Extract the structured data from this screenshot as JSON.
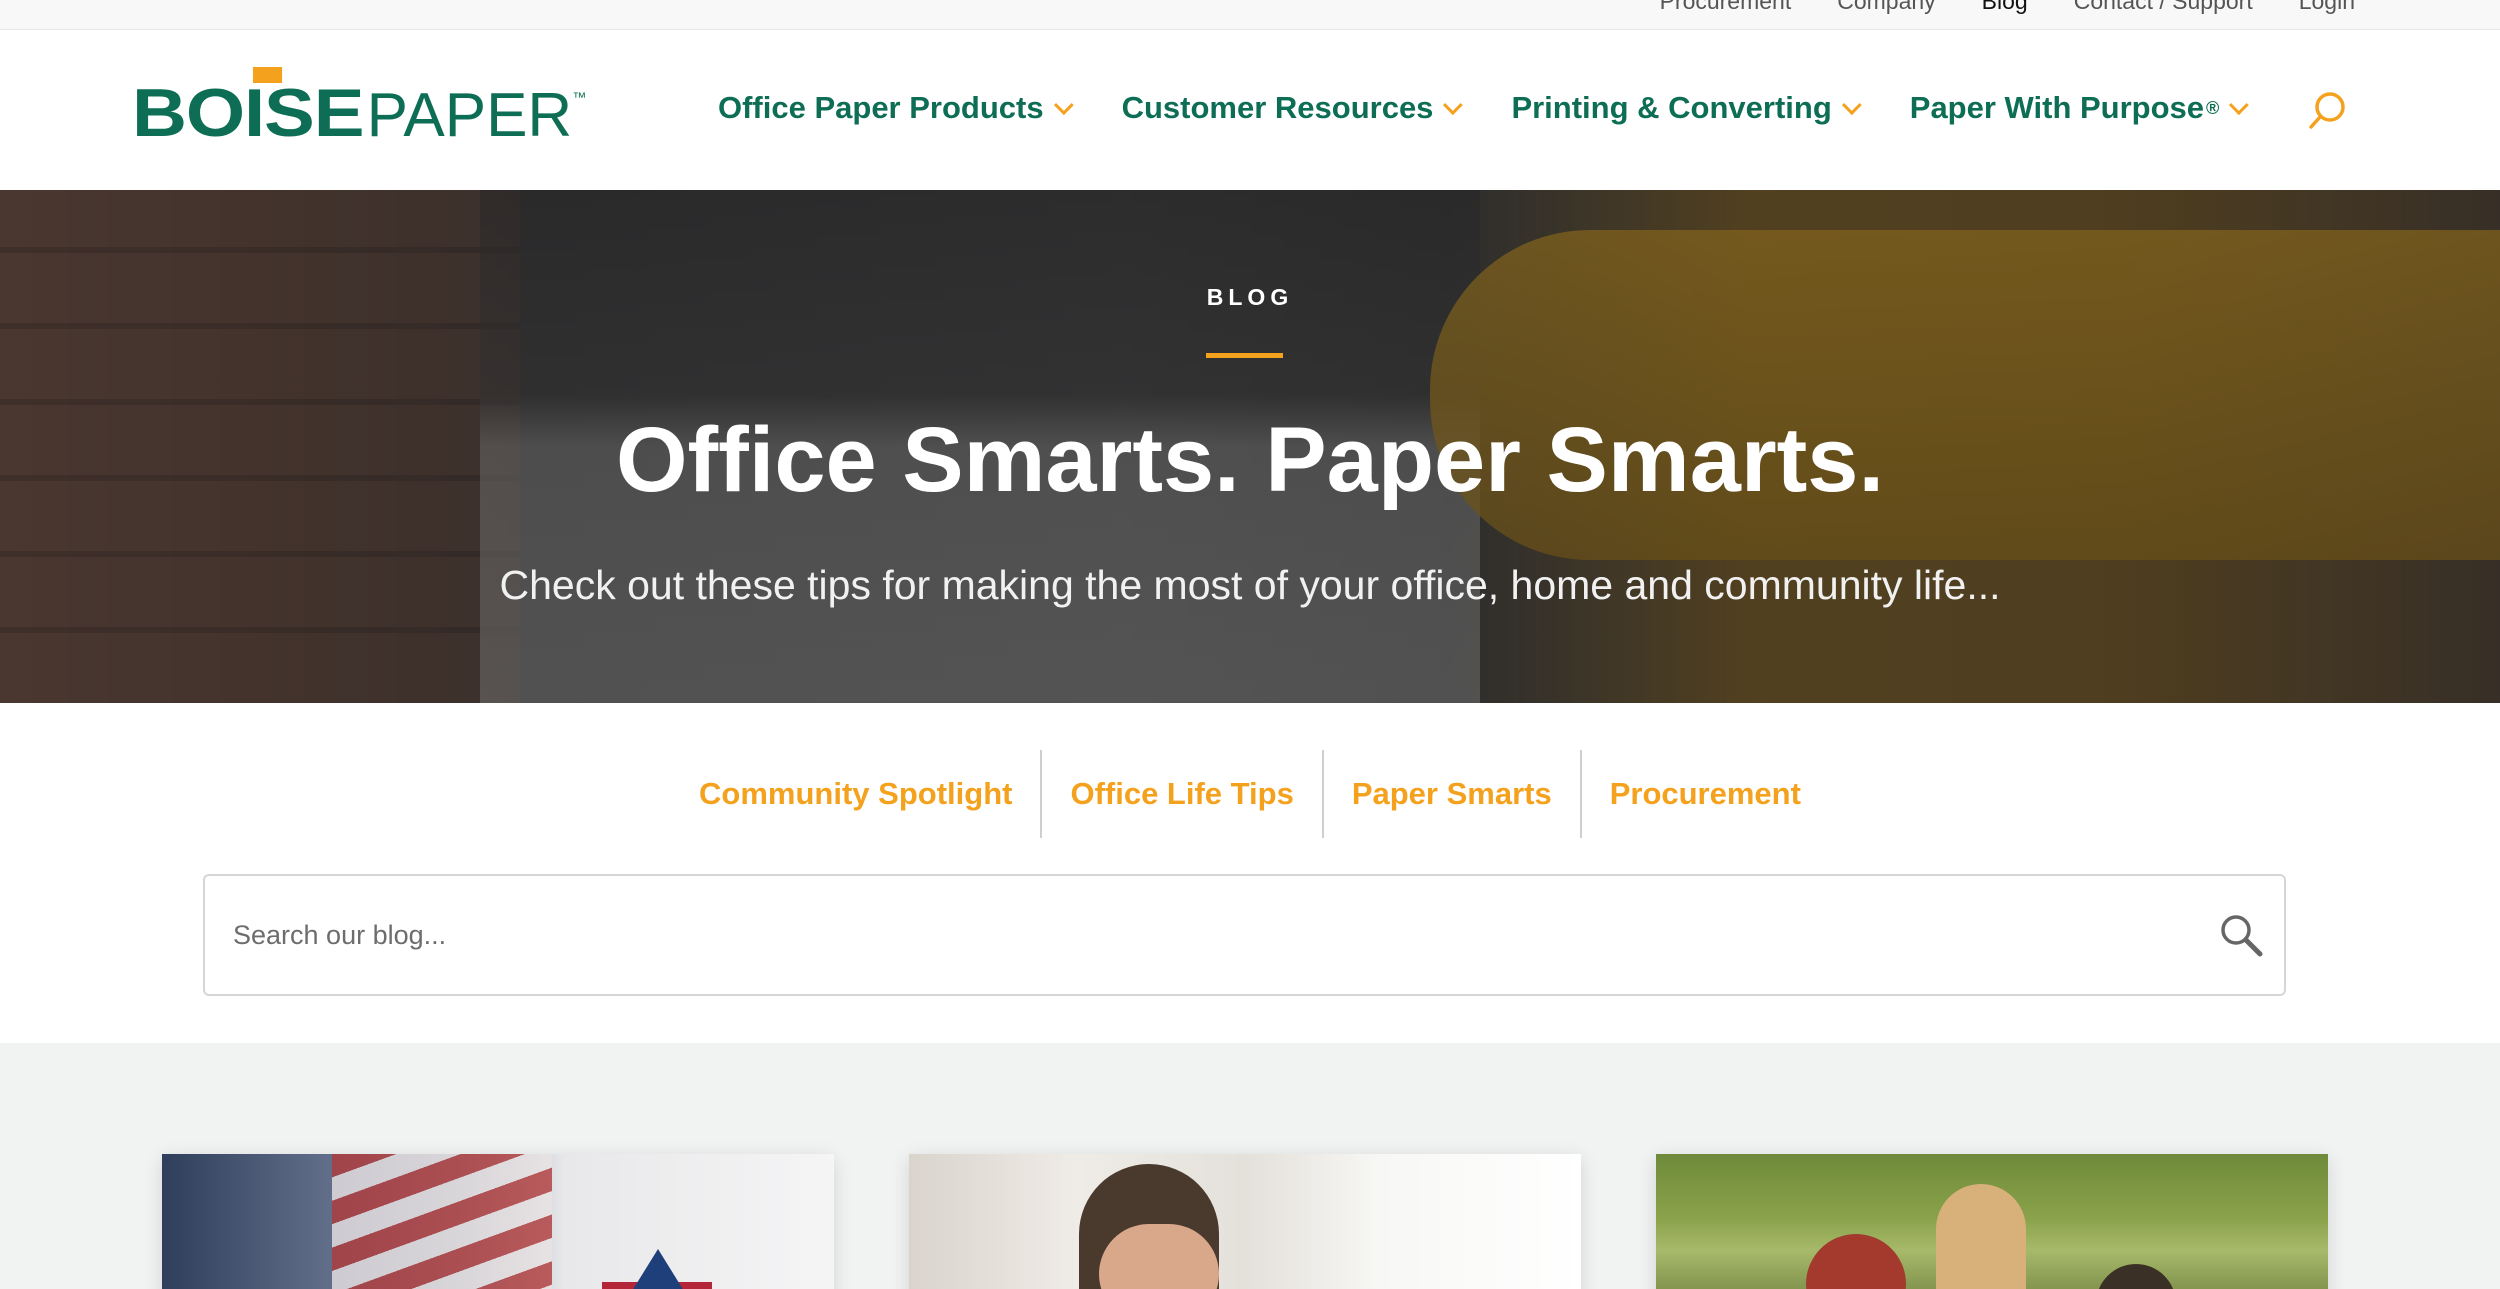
{
  "utility_nav": {
    "items": [
      {
        "label": "Procurement",
        "active": false
      },
      {
        "label": "Company",
        "active": false
      },
      {
        "label": "Blog",
        "active": true
      },
      {
        "label": "Contact / Support",
        "active": false
      },
      {
        "label": "Login",
        "active": false
      }
    ]
  },
  "brand": {
    "logo_word1": "BOISE",
    "logo_word2": "PAPER",
    "logo_tm": "™",
    "colors": {
      "green": "#0e6e55",
      "orange": "#f4a21e"
    }
  },
  "main_nav": {
    "items": [
      {
        "label": "Office Paper Products",
        "sup": ""
      },
      {
        "label": "Customer Resources",
        "sup": ""
      },
      {
        "label": "Printing & Converting",
        "sup": ""
      },
      {
        "label": "Paper With Purpose",
        "sup": "®"
      }
    ],
    "search_icon": "search-icon"
  },
  "hero": {
    "kicker": "BLOG",
    "title": "Office Smarts. Paper Smarts.",
    "subtitle": "Check out these tips for making the most of your office, home and community life..."
  },
  "categories": [
    {
      "label": "Community Spotlight"
    },
    {
      "label": "Office Life Tips"
    },
    {
      "label": "Paper Smarts"
    },
    {
      "label": "Procurement"
    }
  ],
  "blog_search": {
    "placeholder": "Search our blog...",
    "value": "",
    "icon": "magnifier-icon"
  },
  "cards": [
    {
      "image": "flag-image"
    },
    {
      "image": "man-with-glasses-image"
    },
    {
      "image": "outdoor-group-image"
    }
  ]
}
